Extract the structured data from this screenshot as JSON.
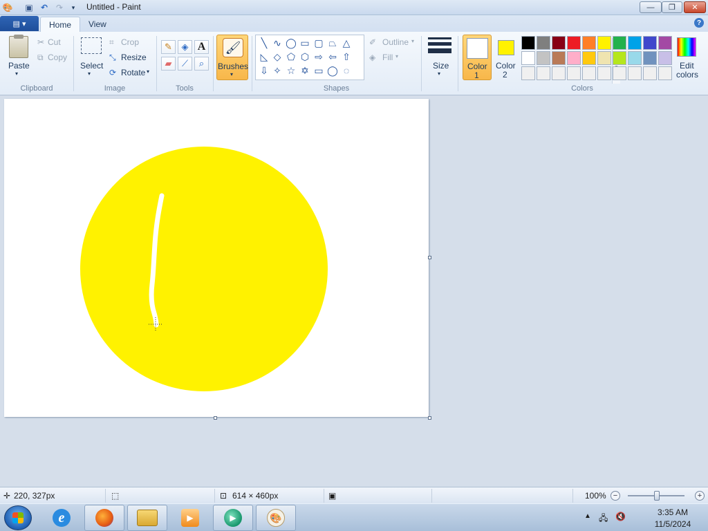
{
  "window": {
    "title": "Untitled - Paint",
    "minimize_glyph": "—",
    "maximize_glyph": "❐",
    "close_glyph": "✕"
  },
  "tabs": [
    {
      "label": "Home",
      "active": true
    },
    {
      "label": "View",
      "active": false
    }
  ],
  "ribbon": {
    "clipboard": {
      "label": "Clipboard",
      "paste": "Paste",
      "cut": "Cut",
      "copy": "Copy"
    },
    "image": {
      "label": "Image",
      "select": "Select",
      "crop": "Crop",
      "resize": "Resize",
      "rotate": "Rotate"
    },
    "tools": {
      "label": "Tools"
    },
    "brushes": {
      "label": "Brushes"
    },
    "shapes": {
      "label": "Shapes",
      "outline": "Outline",
      "fill": "Fill"
    },
    "size": {
      "label": "Size"
    },
    "colors": {
      "label": "Colors",
      "color1_label_line1": "Color",
      "color1_label_line2": "1",
      "color2_label_line1": "Color",
      "color2_label_line2": "2",
      "color1_value": "#ffffff",
      "color2_value": "#fff200",
      "edit_line1": "Edit",
      "edit_line2": "colors",
      "palette_row1": [
        "#000000",
        "#7f7f7f",
        "#880015",
        "#ed1c24",
        "#ff7f27",
        "#fff200",
        "#22b14c",
        "#00a2e8",
        "#3f48cc",
        "#a349a4"
      ],
      "palette_row2": [
        "#ffffff",
        "#c3c3c3",
        "#b97a57",
        "#ffaec9",
        "#ffc90e",
        "#efe4b0",
        "#b5e61d",
        "#99d9ea",
        "#7092be",
        "#c8bfe7"
      ],
      "palette_row3": [
        "#f0f0f0",
        "#f0f0f0",
        "#f0f0f0",
        "#f0f0f0",
        "#f0f0f0",
        "#f0f0f0",
        "#f0f0f0",
        "#f0f0f0",
        "#f0f0f0",
        "#f0f0f0"
      ]
    }
  },
  "canvas": {
    "circle_color": "#fff200",
    "stroke_color": "#ffffff"
  },
  "status": {
    "cursor_pos": "220, 327px",
    "image_size": "614 × 460px",
    "zoom": "100%"
  },
  "taskbar": {
    "time": "3:35 AM",
    "date": "11/5/2024"
  }
}
